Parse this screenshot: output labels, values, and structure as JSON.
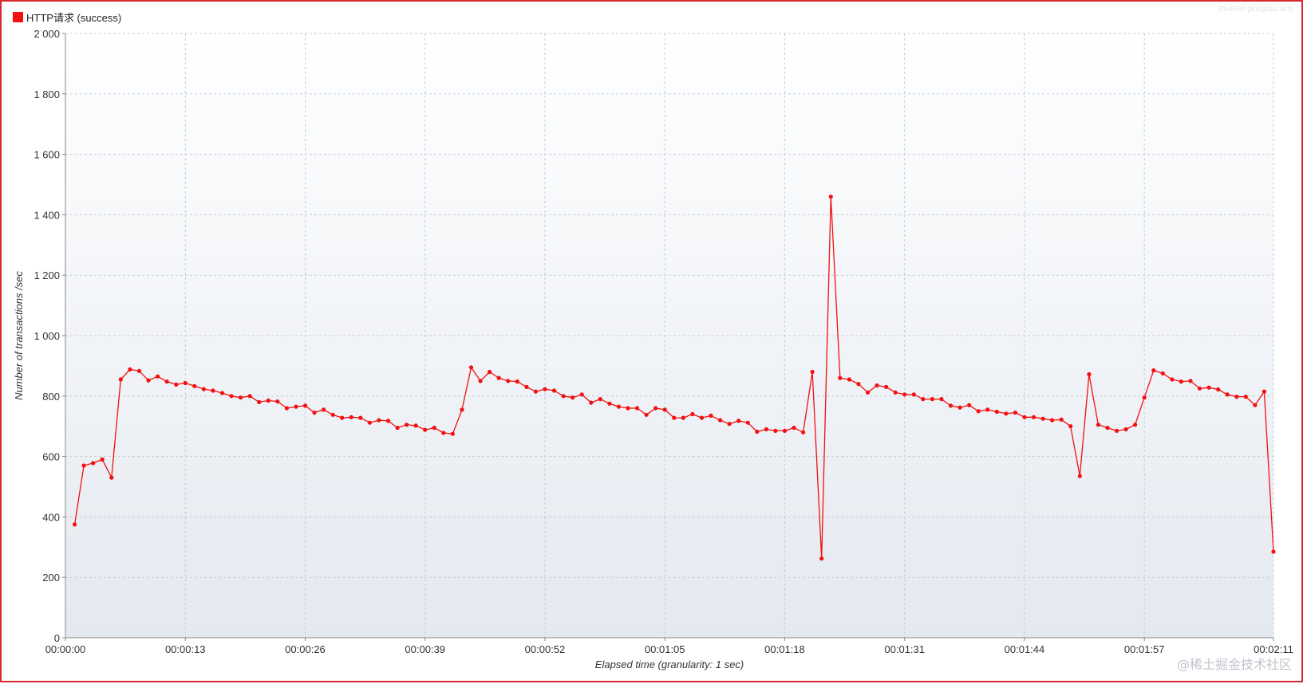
{
  "colors": {
    "series": "#f21010",
    "grid": "#c8ccd2",
    "frame": "#d9282f"
  },
  "watermark": "@稀土掘金技术社区",
  "plot_credit": "jmeter-plugins.org",
  "chart_data": {
    "type": "line",
    "xlabel": "Elapsed time (granularity: 1 sec)",
    "ylabel": "Number of transactions /sec",
    "ylim": [
      0,
      2000
    ],
    "xlim_seconds": [
      0,
      131
    ],
    "grid": true,
    "legend_position": "top-left",
    "y_ticks": [
      0,
      200,
      400,
      600,
      800,
      1000,
      1200,
      1400,
      1600,
      1800,
      2000
    ],
    "y_tick_labels": [
      "0",
      "200",
      "400",
      "600",
      "800",
      "1 000",
      "1 200",
      "1 400",
      "1 600",
      "1 800",
      "2 000"
    ],
    "x_ticks": [
      "00:00:00",
      "00:00:13",
      "00:00:26",
      "00:00:39",
      "00:00:52",
      "00:01:05",
      "00:01:18",
      "00:01:31",
      "00:01:44",
      "00:01:57",
      "00:02:11"
    ],
    "series": [
      {
        "name": "HTTP请求 (success)",
        "x": [
          "00:00:01",
          "00:00:02",
          "00:00:03",
          "00:00:04",
          "00:00:05",
          "00:00:06",
          "00:00:07",
          "00:00:08",
          "00:00:09",
          "00:00:10",
          "00:00:11",
          "00:00:12",
          "00:00:13",
          "00:00:14",
          "00:00:15",
          "00:00:16",
          "00:00:17",
          "00:00:18",
          "00:00:19",
          "00:00:20",
          "00:00:21",
          "00:00:22",
          "00:00:23",
          "00:00:24",
          "00:00:25",
          "00:00:26",
          "00:00:27",
          "00:00:28",
          "00:00:29",
          "00:00:30",
          "00:00:31",
          "00:00:32",
          "00:00:33",
          "00:00:34",
          "00:00:35",
          "00:00:36",
          "00:00:37",
          "00:00:38",
          "00:00:39",
          "00:00:40",
          "00:00:41",
          "00:00:42",
          "00:00:43",
          "00:00:44",
          "00:00:45",
          "00:00:46",
          "00:00:47",
          "00:00:48",
          "00:00:49",
          "00:00:50",
          "00:00:51",
          "00:00:52",
          "00:00:53",
          "00:00:54",
          "00:00:55",
          "00:00:56",
          "00:00:57",
          "00:00:58",
          "00:00:59",
          "00:01:00",
          "00:01:01",
          "00:01:02",
          "00:01:03",
          "00:01:04",
          "00:01:05",
          "00:01:06",
          "00:01:07",
          "00:01:08",
          "00:01:09",
          "00:01:10",
          "00:01:11",
          "00:01:12",
          "00:01:13",
          "00:01:14",
          "00:01:15",
          "00:01:16",
          "00:01:17",
          "00:01:18",
          "00:01:19",
          "00:01:20",
          "00:01:21",
          "00:01:22",
          "00:01:23",
          "00:01:24",
          "00:01:25",
          "00:01:26",
          "00:01:27",
          "00:01:28",
          "00:01:29",
          "00:01:30",
          "00:01:31",
          "00:01:32",
          "00:01:33",
          "00:01:34",
          "00:01:35",
          "00:01:36",
          "00:01:37",
          "00:01:38",
          "00:01:39",
          "00:01:40",
          "00:01:41",
          "00:01:42",
          "00:01:43",
          "00:01:44",
          "00:01:45",
          "00:01:46",
          "00:01:47",
          "00:01:48",
          "00:01:49",
          "00:01:50",
          "00:01:51",
          "00:01:52",
          "00:01:53",
          "00:01:54",
          "00:01:55",
          "00:01:56",
          "00:01:57",
          "00:01:58",
          "00:01:59",
          "00:02:00",
          "00:02:01",
          "00:02:02",
          "00:02:03",
          "00:02:04",
          "00:02:05",
          "00:02:06",
          "00:02:07",
          "00:02:08",
          "00:02:09",
          "00:02:10",
          "00:02:11"
        ],
        "values": [
          375,
          570,
          578,
          590,
          530,
          855,
          888,
          883,
          852,
          865,
          848,
          838,
          843,
          833,
          823,
          818,
          810,
          800,
          795,
          800,
          780,
          785,
          782,
          760,
          765,
          768,
          745,
          755,
          738,
          728,
          730,
          728,
          712,
          720,
          718,
          695,
          705,
          702,
          688,
          695,
          678,
          675,
          755,
          895,
          850,
          880,
          860,
          850,
          848,
          830,
          815,
          823,
          818,
          800,
          795,
          805,
          778,
          790,
          775,
          765,
          760,
          760,
          738,
          760,
          755,
          728,
          728,
          740,
          728,
          735,
          720,
          708,
          718,
          712,
          682,
          690,
          685,
          685,
          695,
          680,
          880,
          262,
          1460,
          860,
          855,
          840,
          812,
          835,
          830,
          812,
          805,
          805,
          790,
          790,
          790,
          768,
          762,
          770,
          750,
          755,
          748,
          742,
          745,
          730,
          730,
          725,
          720,
          722,
          700,
          535,
          872,
          705,
          695,
          685,
          690,
          705,
          795,
          885,
          875,
          855,
          848,
          850,
          825,
          828,
          822,
          805,
          798,
          798,
          770,
          815,
          285
        ]
      }
    ]
  }
}
